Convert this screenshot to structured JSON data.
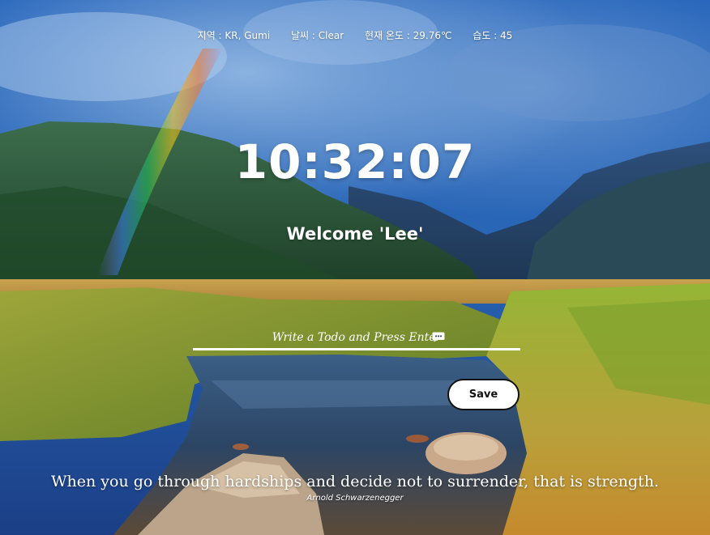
{
  "weather": {
    "location": "지역 : KR, Gumi",
    "condition": "날씨 : Clear",
    "temperature": "현재 온도 : 29.76℃",
    "humidity": "습도 : 45"
  },
  "clock": {
    "time": "10:32:07"
  },
  "greeting": {
    "text": "Welcome 'Lee'"
  },
  "todo": {
    "placeholder": "Write a Todo and Press Enter",
    "value": "",
    "icon": "chat-bubble-icon",
    "save_label": "Save"
  },
  "quote": {
    "text": "When you go through hardships and decide not to surrender, that is strength.",
    "author": "Arnold Schwarzenegger"
  },
  "colors": {
    "text": "#ffffff",
    "button_bg": "#ffffff",
    "button_border": "#111111"
  }
}
